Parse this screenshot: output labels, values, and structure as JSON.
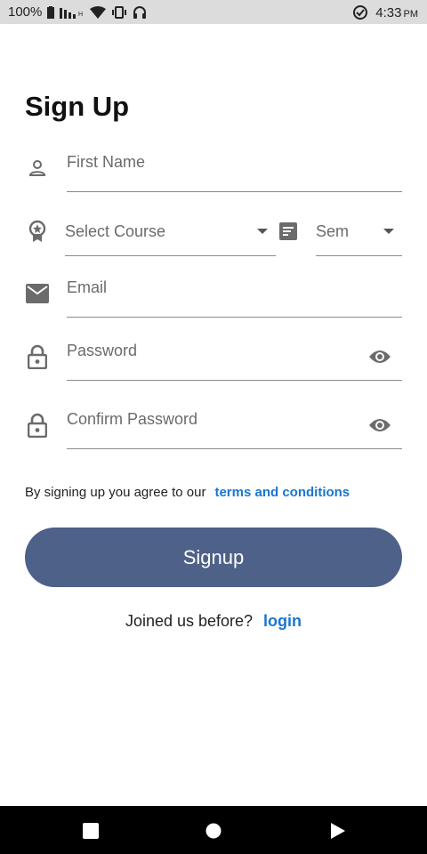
{
  "status_bar": {
    "battery_percent": "100%",
    "time": "4:33",
    "ampm": "PM",
    "icons": [
      "battery-icon",
      "signal-icon",
      "wifi-icon",
      "vibrate-icon",
      "headphones-icon",
      "data-saver-icon"
    ]
  },
  "page": {
    "title": "Sign Up"
  },
  "form": {
    "first_name": {
      "placeholder": "First Name",
      "icon": "person-icon"
    },
    "course": {
      "placeholder": "Select Course",
      "icon": "badge-icon"
    },
    "sem": {
      "placeholder": "Sem",
      "icon": "list-icon"
    },
    "email": {
      "placeholder": "Email",
      "icon": "mail-icon"
    },
    "password": {
      "placeholder": "Password",
      "icon": "lock-icon"
    },
    "confirm_password": {
      "placeholder": "Confirm Password",
      "icon": "lock-icon"
    }
  },
  "terms": {
    "text": "By signing up you agree to our",
    "link": "terms and conditions"
  },
  "signup_button": "Signup",
  "login": {
    "text": "Joined us before?",
    "link": "login"
  },
  "colors": {
    "primary_button": "#4e6188",
    "link": "#1976d2",
    "icon": "#6b6b6b"
  }
}
